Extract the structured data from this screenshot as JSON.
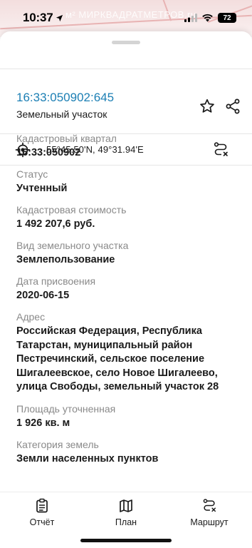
{
  "status_bar": {
    "time": "10:37",
    "watermark": "м² МИРКВАДРАТМЕТРОВ.ru",
    "battery": "72",
    "icons": [
      "location-arrow-icon",
      "signal-icon",
      "wifi-icon",
      "battery-icon"
    ]
  },
  "header": {
    "cadastral_number": "16:33:050902:645",
    "object_type": "Земельный участок",
    "accent_color": "#1c7fb4"
  },
  "coords": {
    "text": "55°45.50'N, 49°31.94'E"
  },
  "fields": [
    {
      "label": "Кадастровый квартал",
      "value": "16:33:050902"
    },
    {
      "label": "Статус",
      "value": "Учтенный"
    },
    {
      "label": "Кадастровая стоимость",
      "value": "1 492 207,6 руб."
    },
    {
      "label": "Вид земельного участка",
      "value": "Землепользование"
    },
    {
      "label": "Дата присвоения",
      "value": "2020-06-15"
    },
    {
      "label": "Адрес",
      "value": "Российская Федерация, Республика Татарстан, муниципальный район Пестречинский, сельское поселение Шигалеевское, село Новое Шигалеево, улица Свободы, земельный участок 28"
    },
    {
      "label": "Площадь уточненная",
      "value": "1 926 кв. м"
    },
    {
      "label": "Категория земель",
      "value": "Земли населенных пунктов"
    }
  ],
  "bottom_nav": {
    "report": "Отчёт",
    "plan": "План",
    "route": "Маршрут"
  }
}
